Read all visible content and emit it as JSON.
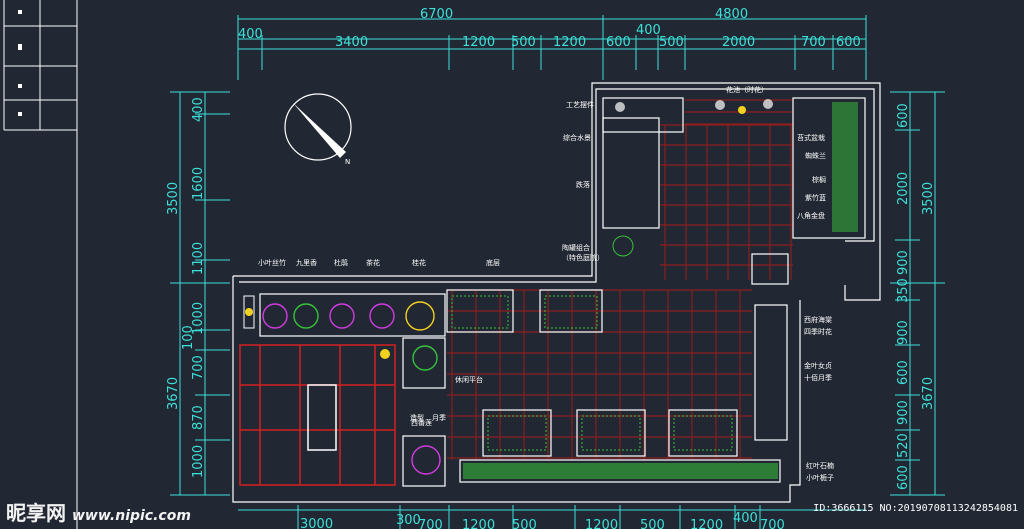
{
  "dimensions": {
    "top_total": [
      "6700",
      "4800"
    ],
    "top_mid": [
      "400"
    ],
    "top_segments": [
      "400",
      "3400",
      "1200",
      "500",
      "1200",
      "600",
      "500",
      "2000",
      "700",
      "600"
    ],
    "bottom_segments": [
      "3000",
      "300",
      "700",
      "1200",
      "500",
      "1200",
      "500",
      "1200",
      "400",
      "700"
    ],
    "left_outer": [
      "3500",
      "3670"
    ],
    "left_inner": [
      "400",
      "1600",
      "1100",
      "1000",
      "100",
      "700",
      "870",
      "1000"
    ],
    "right_outer": [
      "3500",
      "3670"
    ],
    "right_inner": [
      "600",
      "2000",
      "900",
      "350",
      "900",
      "600",
      "900",
      "520",
      "600"
    ]
  },
  "labels": {
    "garden_bed_top": "花池（时花）",
    "craft_ornament": "工艺摆件",
    "water_plants": "综合水景",
    "waterfall": "跌落",
    "pottery_pot": "陶罐组合",
    "pottery_pot_sub": "（特色庭院）",
    "bamboo_planter": "苔式盆栽",
    "iris": "蜘蛛兰",
    "palm": "棕榈",
    "succulent": "紫竹蓝",
    "octagon_pot": "八角金盘",
    "grass_left": "小叶丝竹",
    "nine_mile": "九里香",
    "osmanthus": "桂花",
    "azalea": "杜鹃",
    "camellia": "茶花",
    "soil_bed": "底层",
    "deck": "休闲平台",
    "wood_deck": "西番莲",
    "ornament": "造型",
    "rose": "月季",
    "right_box1": "西府海棠",
    "right_box1b": "四季时花",
    "right_box2": "金叶女贞",
    "right_box2b": "十佰月季",
    "hedge_a": "红叶石楠",
    "hedge_b": "小叶栀子"
  },
  "watermark": {
    "brand": "昵享网",
    "site": "www.nipic.com"
  },
  "meta_text": "ID:3666115 NO:20190708113242854081",
  "colors": {
    "background": "#222833",
    "dimension": "#3be0d8",
    "outline": "#ffffff",
    "paving": "#8b1e1e",
    "planting": "#36c23a",
    "flower": "#d13be0",
    "gold": "#f2d21e"
  }
}
